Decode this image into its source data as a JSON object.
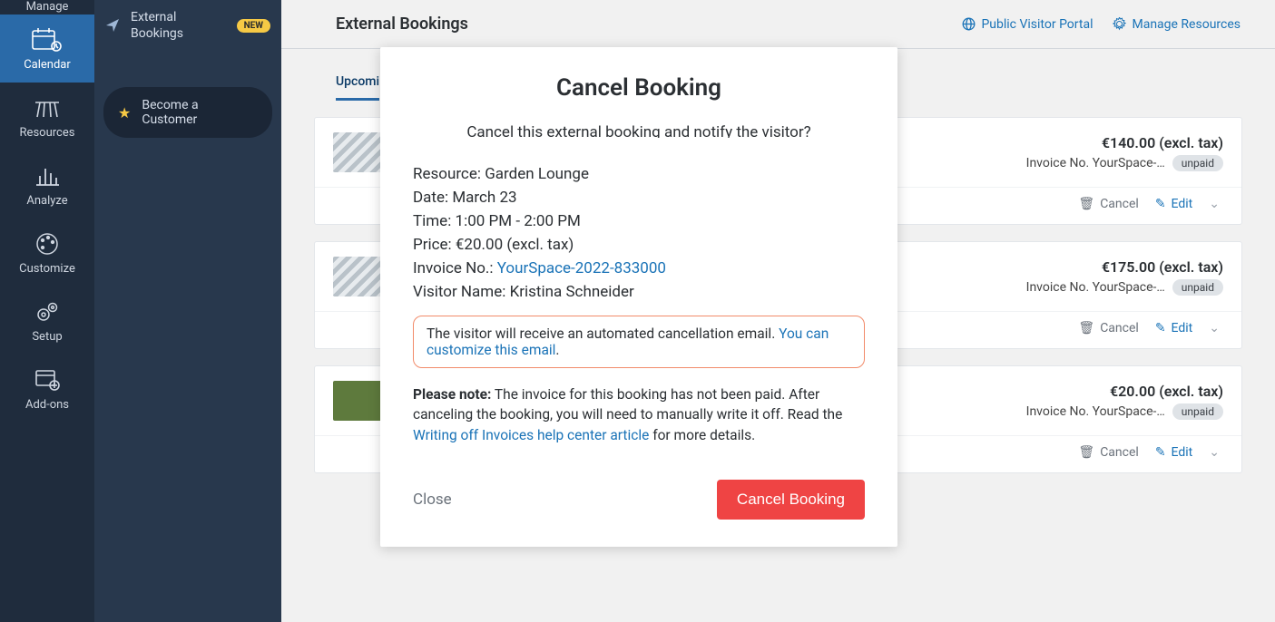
{
  "sidebar_narrow": {
    "items": [
      {
        "label": "Manage"
      },
      {
        "label": "Calendar"
      },
      {
        "label": "Resources"
      },
      {
        "label": "Analyze"
      },
      {
        "label": "Customize"
      },
      {
        "label": "Setup"
      },
      {
        "label": "Add-ons"
      }
    ]
  },
  "sidebar_wide": {
    "external": {
      "line1": "External",
      "line2": "Bookings",
      "badge": "NEW"
    },
    "become": {
      "line1": "Become a",
      "line2": "Customer"
    }
  },
  "topbar": {
    "title": "External Bookings",
    "link_portal": "Public Visitor Portal",
    "link_resources": "Manage Resources"
  },
  "tabs": {
    "upcoming": "Upcomi"
  },
  "cards": [
    {
      "price": "€140.00 (excl. tax)",
      "invoice_prefix": "Invoice No. YourSpace-…",
      "status": "unpaid",
      "cancel": "Cancel",
      "edit": "Edit"
    },
    {
      "price": "€175.00 (excl. tax)",
      "invoice_prefix": "Invoice No. YourSpace-…",
      "status": "unpaid",
      "cancel": "Cancel",
      "edit": "Edit"
    },
    {
      "price": "€20.00 (excl. tax)",
      "invoice_prefix": "Invoice No. YourSpace-…",
      "status": "unpaid",
      "cancel": "Cancel",
      "edit": "Edit"
    }
  ],
  "modal": {
    "title": "Cancel Booking",
    "subtitle": "Cancel this external booking and notify the visitor?",
    "resource_label": "Resource: ",
    "resource_value": "Garden Lounge",
    "date_label": "Date: ",
    "date_value": "March 23",
    "time_label": "Time: ",
    "time_value": "1:00 PM - 2:00 PM",
    "price_label": "Price: ",
    "price_value": "€20.00 (excl. tax)",
    "invoice_label": "Invoice No.: ",
    "invoice_link": "YourSpace-2022-833000",
    "visitor_label": "Visitor Name: ",
    "visitor_value": "Kristina Schneider",
    "callout_text": "The visitor will receive an automated cancellation email. ",
    "callout_link": "You can customize this email",
    "callout_suffix": ".",
    "note_strong": "Please note:",
    "note_body1": " The invoice for this booking has not been paid. After canceling the booking, you will need to manually write it off. Read the ",
    "note_link": "Writing off Invoices help center article",
    "note_body2": " for more details.",
    "close": "Close",
    "confirm": "Cancel Booking"
  }
}
